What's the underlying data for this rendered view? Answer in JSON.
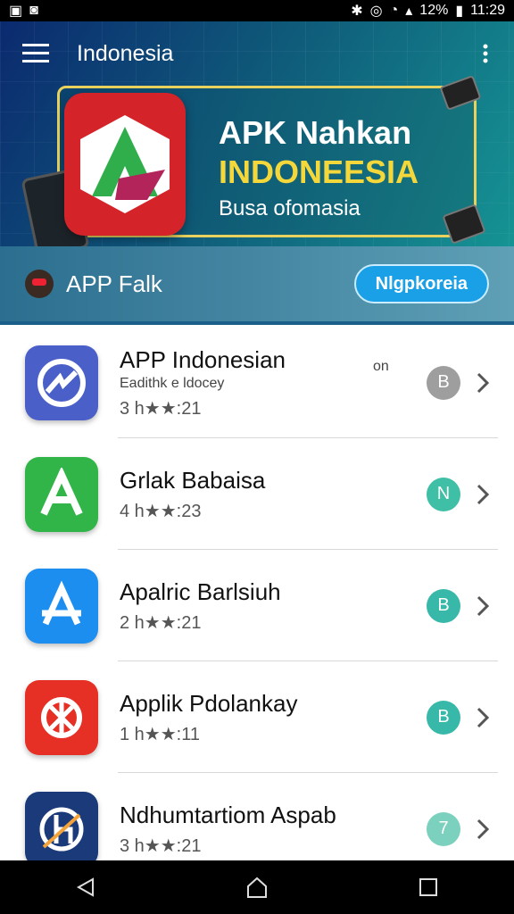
{
  "status_bar": {
    "battery_percent": "12%",
    "time": "11:29"
  },
  "app_bar": {
    "title": "Indonesia"
  },
  "banner": {
    "line1": "APK Nahkan",
    "line2": "INDONEESIA",
    "subtitle": "Busa ofomasia"
  },
  "sub_bar": {
    "label": "APP Falk",
    "button_label": "Nlgpkoreia"
  },
  "apps": [
    {
      "name": "APP Indonesian",
      "sub": "Eadithk e ldocey",
      "rating": "3 h★★:21",
      "extra": "on",
      "badge": "B",
      "badge_color": "#9e9e9e",
      "icon_color": "#4a60c8"
    },
    {
      "name": "Grlak Babaisa",
      "sub": "",
      "rating": "4 h★★:23",
      "extra": "",
      "badge": "N",
      "badge_color": "#3fbfa5",
      "icon_color": "#31b549"
    },
    {
      "name": "Apalric Barlsiuh",
      "sub": "",
      "rating": "2 h★★:21",
      "extra": "",
      "badge": "B",
      "badge_color": "#38b8a8",
      "icon_color": "#1c8ef0"
    },
    {
      "name": "Applik Pdolankay",
      "sub": "",
      "rating": "1 h★★:11",
      "extra": "",
      "badge": "B",
      "badge_color": "#38b8a8",
      "icon_color": "#e63025"
    },
    {
      "name": "Ndhumtartiom Aspab",
      "sub": "",
      "rating": "3 h★★:21",
      "extra": "",
      "badge": "7",
      "badge_color": "#7bd1bd",
      "icon_color": "#1b3a7a"
    }
  ]
}
